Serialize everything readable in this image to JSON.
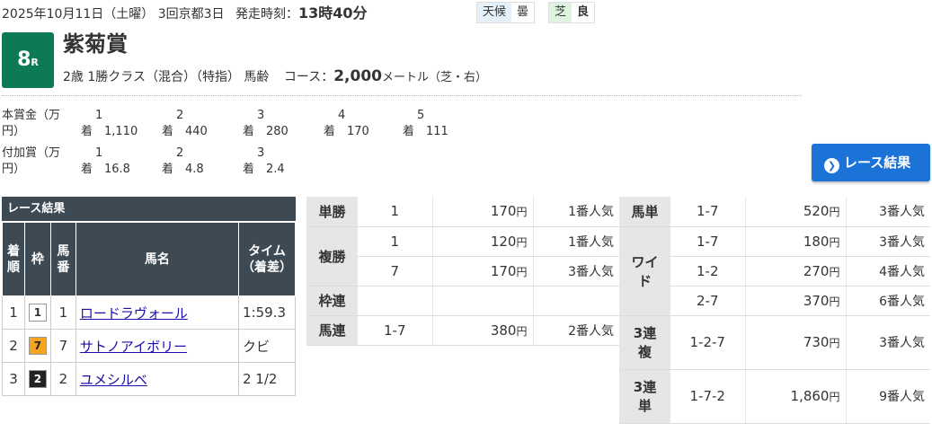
{
  "header": {
    "date": "2025年10月11日（土曜） 3回京都3日",
    "start_label": "発走時刻：",
    "start_time": "13時40分",
    "weather_label": "天候",
    "weather": "曇",
    "track_label": "芝",
    "track_cond": "良"
  },
  "race": {
    "num": "8",
    "unit": "R",
    "name": "紫菊賞",
    "conditions": "2歳 1勝クラス（混合）（特指） 馬齢",
    "course_label": "コース：",
    "distance": "2,000",
    "dist_unit": "メートル（芝・右）"
  },
  "prize": {
    "label1": "本賞金（万",
    "label1b": "円）",
    "label2": "付加賞（万",
    "label2b": "円）",
    "main": [
      [
        "1",
        "着",
        "1,110"
      ],
      [
        "2",
        "着",
        "440"
      ],
      [
        "3",
        "着",
        "280"
      ],
      [
        "4",
        "着",
        "170"
      ],
      [
        "5",
        "着",
        "111"
      ]
    ],
    "add": [
      [
        "1",
        "着",
        "16.8"
      ],
      [
        "2",
        "着",
        "4.8"
      ],
      [
        "3",
        "着",
        "2.4"
      ]
    ]
  },
  "result_button": "レース結果",
  "results": {
    "caption": "レース結果",
    "headers": [
      "着順",
      "枠",
      "馬番",
      "馬名",
      "タイム（着差）"
    ],
    "rows": [
      {
        "pos": "1",
        "waku": "1",
        "num": "1",
        "name": "ロードラヴォール",
        "time": "1:59.3"
      },
      {
        "pos": "2",
        "waku": "7",
        "num": "7",
        "name": "サトノアイボリー",
        "time": "クビ"
      },
      {
        "pos": "3",
        "waku": "2",
        "num": "2",
        "name": "ユメシルベ",
        "time": "2 1/2"
      }
    ]
  },
  "payout": {
    "yen": "円",
    "left": [
      {
        "type": "単勝",
        "rows": [
          {
            "combo": "1",
            "amount": "170",
            "pop": "1番人気"
          }
        ]
      },
      {
        "type": "複勝",
        "rows": [
          {
            "combo": "1",
            "amount": "120",
            "pop": "1番人気"
          },
          {
            "combo": "7",
            "amount": "170",
            "pop": "3番人気"
          }
        ]
      },
      {
        "type": "枠連",
        "rows": [
          {
            "combo": "",
            "amount": "",
            "pop": ""
          }
        ]
      },
      {
        "type": "馬連",
        "rows": [
          {
            "combo": "1-7",
            "amount": "380",
            "pop": "2番人気"
          }
        ]
      }
    ],
    "right": [
      {
        "type": "馬単",
        "rows": [
          {
            "combo": "1-7",
            "amount": "520",
            "pop": "3番人気"
          }
        ]
      },
      {
        "type": "ワイド",
        "rows": [
          {
            "combo": "1-7",
            "amount": "180",
            "pop": "3番人気"
          },
          {
            "combo": "1-2",
            "amount": "270",
            "pop": "4番人気"
          },
          {
            "combo": "2-7",
            "amount": "370",
            "pop": "6番人気"
          }
        ]
      },
      {
        "type": "3連複",
        "rows": [
          {
            "combo": "1-2-7",
            "amount": "730",
            "pop": "3番人気"
          }
        ]
      },
      {
        "type": "3連単",
        "rows": [
          {
            "combo": "1-7-2",
            "amount": "1,860",
            "pop": "9番人気"
          }
        ]
      }
    ]
  },
  "colors": {
    "waku1": "#ffffff",
    "waku7": "#f7a521",
    "waku2": "#222222",
    "badge": "#0c7b55",
    "button": "#1b73d8"
  }
}
